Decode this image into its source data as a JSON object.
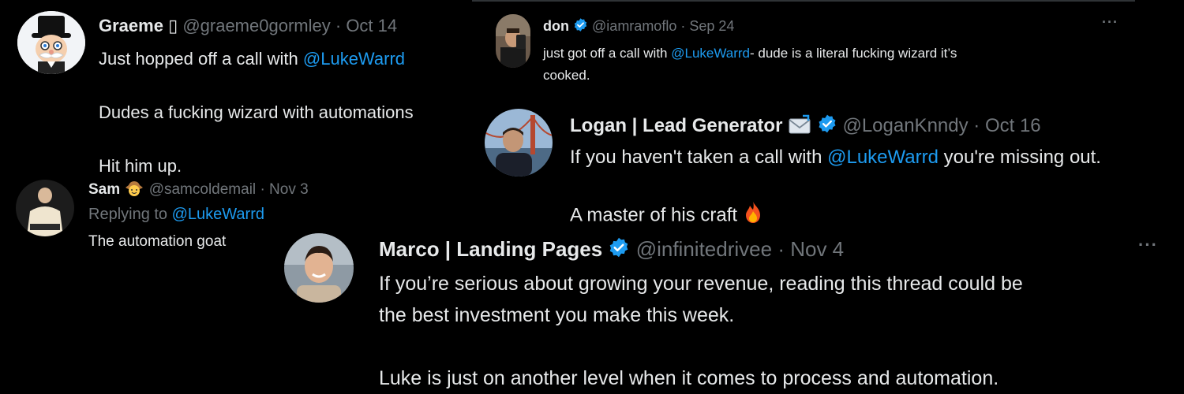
{
  "colors": {
    "background": "#000000",
    "text": "#e7e9ea",
    "muted": "#71767b",
    "mention": "#1d9bf0",
    "verified": "#1d9bf0"
  },
  "tweets": [
    {
      "name": "Graeme",
      "name_suffix": "▯",
      "handle": "@graeme0gormley",
      "separator": "·",
      "date": "Oct 14",
      "avatar_icon": "monopoly-man-avatar",
      "line1_prefix": "Just hopped off a call with",
      "mention": "@LukeWarrd",
      "line2": "Dudes a fucking wizard with automations",
      "line3": "Hit him up."
    },
    {
      "name": "don",
      "verified": true,
      "handle": "@iamramoflo",
      "separator": "·",
      "date": "Sep 24",
      "more": "···",
      "avatar_icon": "selfie-avatar",
      "line1_prefix": "just got off a call with",
      "mention": "@LukeWarrd",
      "line1_suffix": "- dude is a literal fucking wizard it’s",
      "line2": "cooked."
    },
    {
      "name": "Logan | Lead Generator",
      "name_emoji": "envelope-icon",
      "verified": true,
      "handle": "@LoganKnndy",
      "separator": "·",
      "date": "Oct 16",
      "avatar_icon": "golden-gate-avatar",
      "line1_prefix": "If you haven't taken a call with",
      "mention": "@LukeWarrd",
      "line1_suffix": "you're missing out.",
      "line2": "A master of his craft",
      "line2_emoji": "fire-icon"
    },
    {
      "name": "Sam",
      "name_emoji": "cowboy-emoji",
      "handle": "@samcoldemail",
      "separator": "·",
      "date": "Nov 3",
      "avatar_icon": "person-avatar",
      "replying_label": "Replying to",
      "replying_to": "@LukeWarrd",
      "line1": "The automation goat"
    },
    {
      "name": "Marco | Landing Pages",
      "verified": true,
      "handle": "@infinitedrivee",
      "separator": "·",
      "date": "Nov 4",
      "more": "···",
      "avatar_icon": "smiling-man-avatar",
      "line1": "If you’re serious about growing your revenue, reading this thread could be",
      "line2": "the best investment you make this week.",
      "line3": "Luke is just on another level when it comes to process and automation."
    }
  ]
}
